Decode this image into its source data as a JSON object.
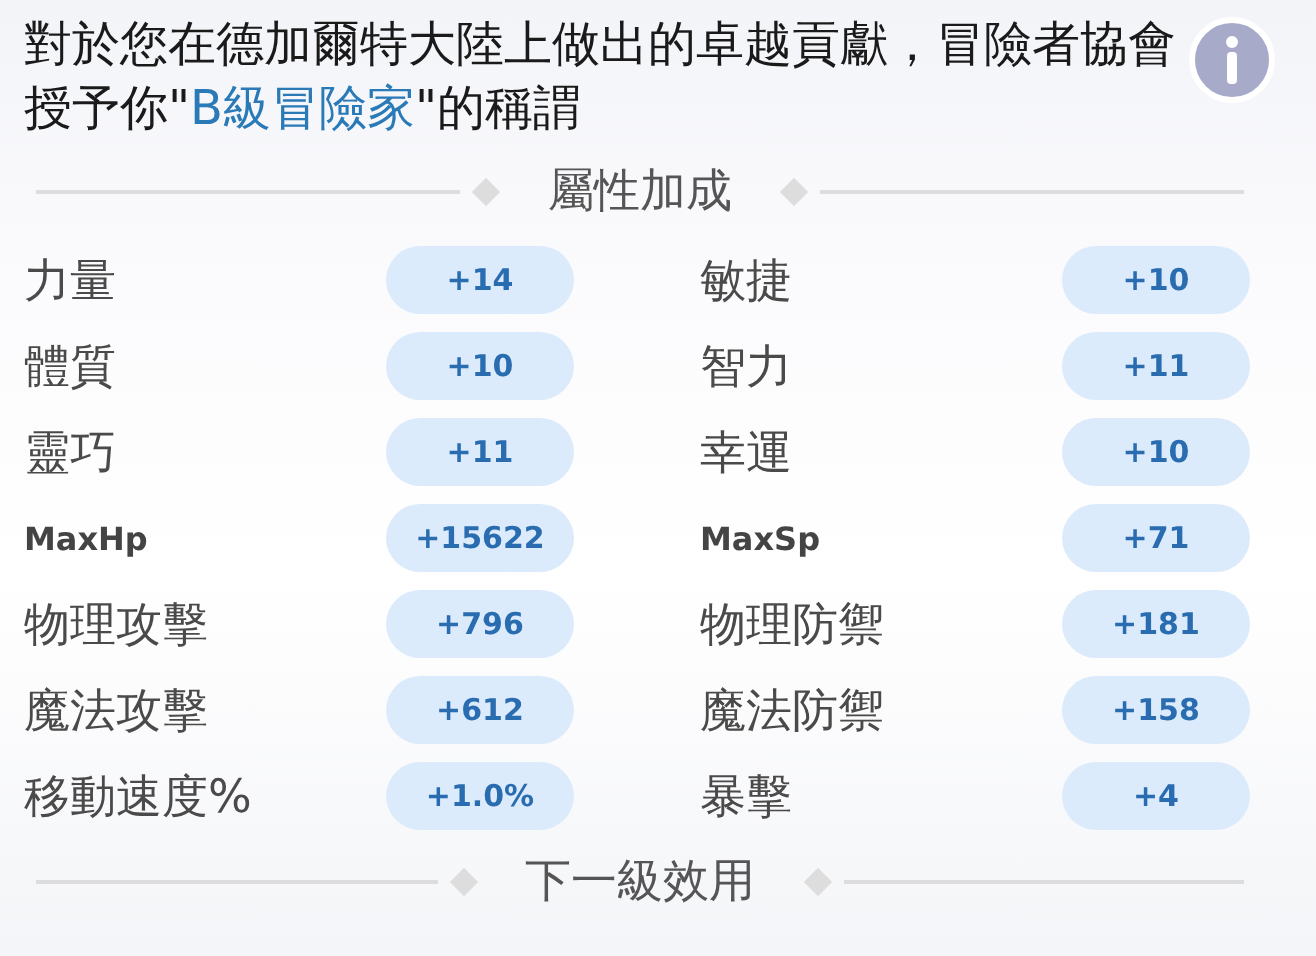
{
  "description": {
    "before": "對於您在德加爾特大陸上做出的卓越貢獻，冒險者協會授予你\"",
    "highlight": "B級冒險家",
    "after": "\"的稱謂"
  },
  "sections": [
    {
      "title": "屬性加成"
    },
    {
      "title": "下一級效用"
    }
  ],
  "stats": [
    {
      "label": "力量",
      "value": "+14"
    },
    {
      "label": "敏捷",
      "value": "+10"
    },
    {
      "label": "體質",
      "value": "+10"
    },
    {
      "label": "智力",
      "value": "+11"
    },
    {
      "label": "靈巧",
      "value": "+11"
    },
    {
      "label": "幸運",
      "value": "+10"
    },
    {
      "label": "MaxHp",
      "value": "+15622"
    },
    {
      "label": "MaxSp",
      "value": "+71"
    },
    {
      "label": "物理攻擊",
      "value": "+796"
    },
    {
      "label": "物理防禦",
      "value": "+181"
    },
    {
      "label": "魔法攻擊",
      "value": "+612"
    },
    {
      "label": "魔法防禦",
      "value": "+158"
    },
    {
      "label": "移動速度%",
      "value": "+1.0%"
    },
    {
      "label": "暴擊",
      "value": "+4"
    }
  ]
}
